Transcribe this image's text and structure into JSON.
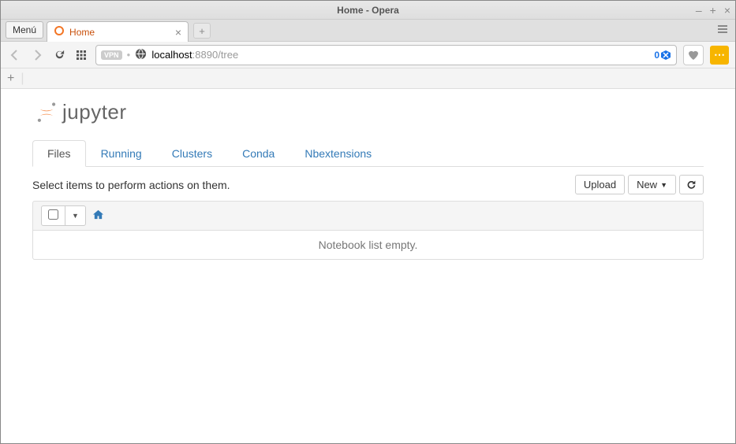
{
  "window": {
    "title": "Home - Opera"
  },
  "browser": {
    "menu_label": "Menú",
    "tab_title": "Home",
    "address_host": "localhost",
    "address_rest": ":8890/tree",
    "vpn_label": "VPN",
    "blocked_count": "0"
  },
  "jupyter": {
    "logo_text": "jupyter",
    "tabs": {
      "files": "Files",
      "running": "Running",
      "clusters": "Clusters",
      "conda": "Conda",
      "nbextensions": "Nbextensions"
    },
    "hint": "Select items to perform actions on them.",
    "upload_label": "Upload",
    "new_label": "New",
    "empty_message": "Notebook list empty."
  }
}
